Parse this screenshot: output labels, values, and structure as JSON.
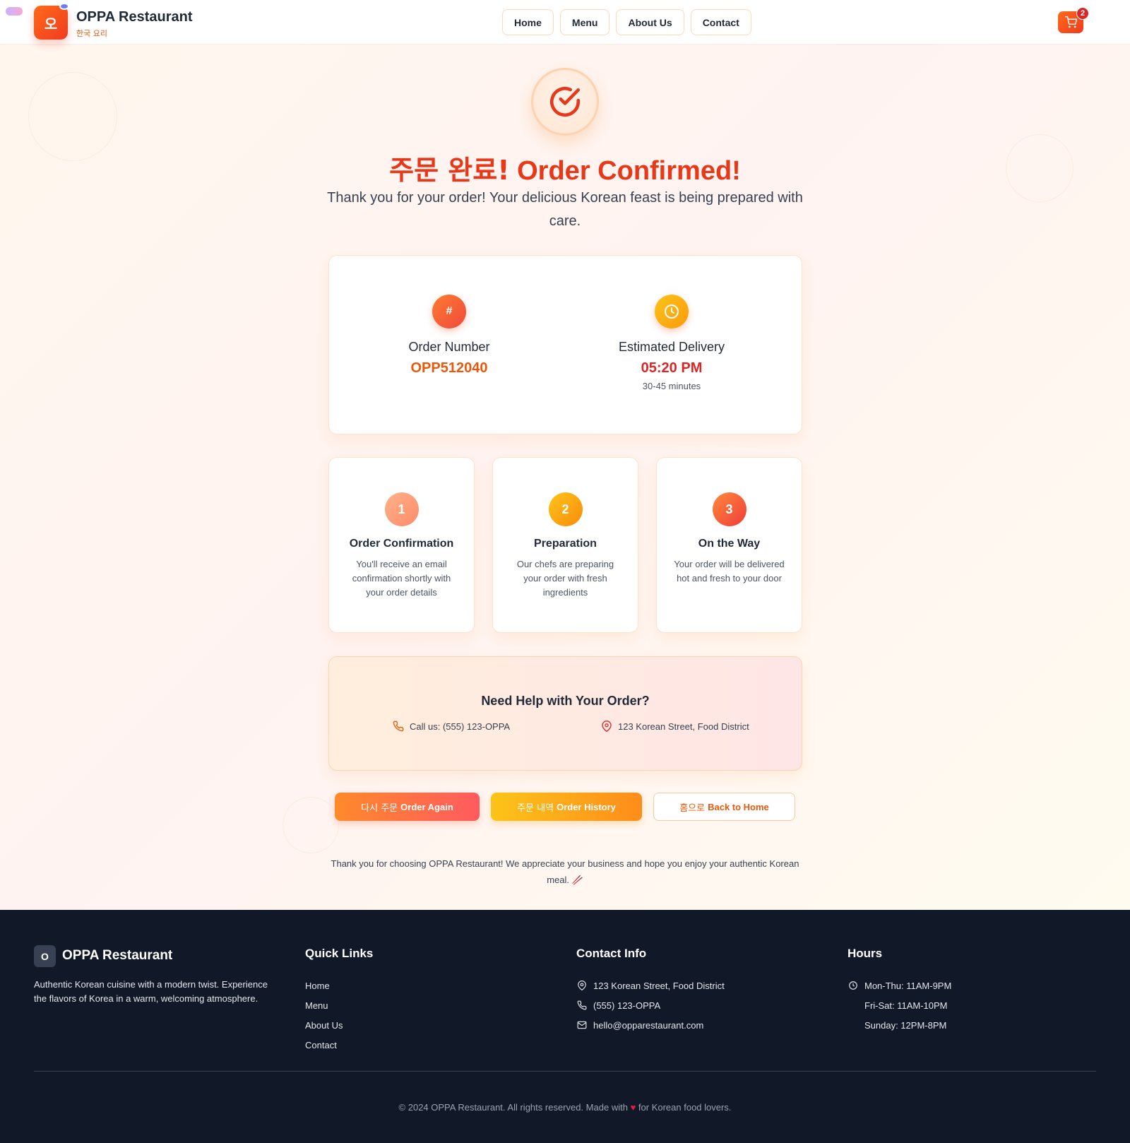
{
  "header": {
    "logo_char": "오",
    "brand": "OPPA Restaurant",
    "brand_sub": "한국 요리",
    "nav": [
      "Home",
      "Menu",
      "About Us",
      "Contact"
    ],
    "cart_count": "2"
  },
  "confirmation": {
    "title_ko": "주문 완료!",
    "title_en": "Order Confirmed!",
    "subtitle": "Thank you for your order! Your delicious Korean feast is being prepared with care."
  },
  "order": {
    "number_icon": "#",
    "number_label": "Order Number",
    "number_value": "OPP512040",
    "delivery_label": "Estimated Delivery",
    "delivery_time": "05:20 PM",
    "delivery_note": "30-45 minutes"
  },
  "steps": [
    {
      "num": "1",
      "title": "Order Confirmation",
      "desc": "You'll receive an email confirmation shortly with your order details"
    },
    {
      "num": "2",
      "title": "Preparation",
      "desc": "Our chefs are preparing your order with fresh ingredients"
    },
    {
      "num": "3",
      "title": "On the Way",
      "desc": "Your order will be delivered hot and fresh to your door"
    }
  ],
  "help": {
    "title": "Need Help with Your Order?",
    "phone": "Call us: (555) 123-OPPA",
    "address": "123 Korean Street, Food District"
  },
  "actions": {
    "again_ko": "다시 주문",
    "again_en": "Order Again",
    "history_ko": "주문 내역",
    "history_en": "Order History",
    "home_ko": "홈으로",
    "home_en": "Back to Home"
  },
  "thanks_text": "Thank you for choosing OPPA Restaurant! We appreciate your business and hope you enjoy your authentic Korean meal. 🥢",
  "footer": {
    "logo_char": "O",
    "brand": "OPPA Restaurant",
    "description": "Authentic Korean cuisine with a modern twist. Experience the flavors of Korea in a warm, welcoming atmosphere.",
    "quick_links_title": "Quick Links",
    "quick_links": [
      "Home",
      "Menu",
      "About Us",
      "Contact"
    ],
    "contact_title": "Contact Info",
    "contact": {
      "address": "123 Korean Street, Food District",
      "phone": "(555) 123-OPPA",
      "email": "hello@opparestaurant.com"
    },
    "hours_title": "Hours",
    "hours": [
      "Mon-Thu: 11AM-9PM",
      "Fri-Sat: 11AM-10PM",
      "Sunday: 12PM-8PM"
    ],
    "copyright_before": "© 2024 OPPA Restaurant. All rights reserved. Made with",
    "copyright_heart": "♥",
    "copyright_after": "for Korean food lovers."
  },
  "colors": {
    "accent": "#e8381a",
    "orange": "#ff6a1a",
    "amber": "#fcc419",
    "footer_bg": "#111827"
  }
}
